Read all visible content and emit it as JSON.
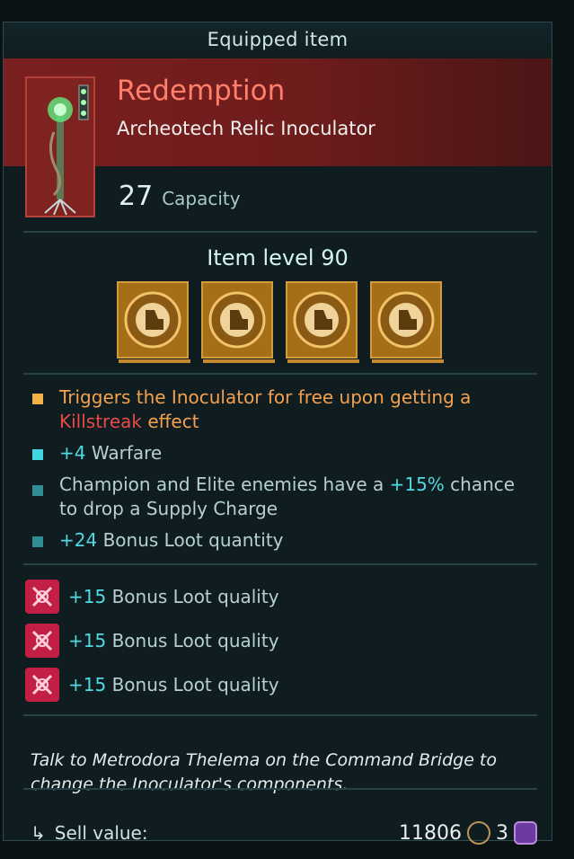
{
  "header": {
    "title": "Equipped item"
  },
  "item": {
    "name": "Redemption",
    "type": "Archeotech Relic Inoculator",
    "capacity_value": "27",
    "capacity_label": "Capacity",
    "level_label": "Item level 90",
    "component_slots": 4
  },
  "effects": [
    {
      "bullet": "orange",
      "text_a": "Triggers the Inoculator for free upon getting a ",
      "highlight": "Killstreak",
      "text_b": " effect"
    },
    {
      "bullet": "cyan",
      "value": "+4",
      "text": " Warfare"
    },
    {
      "bullet": "teal",
      "text_a": "Champion and Elite enemies have a ",
      "value": "+15%",
      "text_b": " chance to drop a Supply Charge"
    },
    {
      "bullet": "teal",
      "value": "+24",
      "text": " Bonus Loot quantity"
    }
  ],
  "bonuses": [
    {
      "value": "+15",
      "text": " Bonus Loot quality"
    },
    {
      "value": "+15",
      "text": " Bonus Loot quality"
    },
    {
      "value": "+15",
      "text": " Bonus Loot quality"
    }
  ],
  "note": "Talk to Metrodora Thelema on the Command Bridge to change the Inoculator's components.",
  "footer": {
    "sell_label": "Sell value:",
    "coins": "11806",
    "skulls": "3"
  },
  "colors": {
    "accent_red": "#ff7f6b",
    "bullet_orange": "#f0b34a",
    "bullet_cyan": "#3fd6e2",
    "bullet_teal": "#2f8d93",
    "bonus_icon": "#c21f45"
  }
}
